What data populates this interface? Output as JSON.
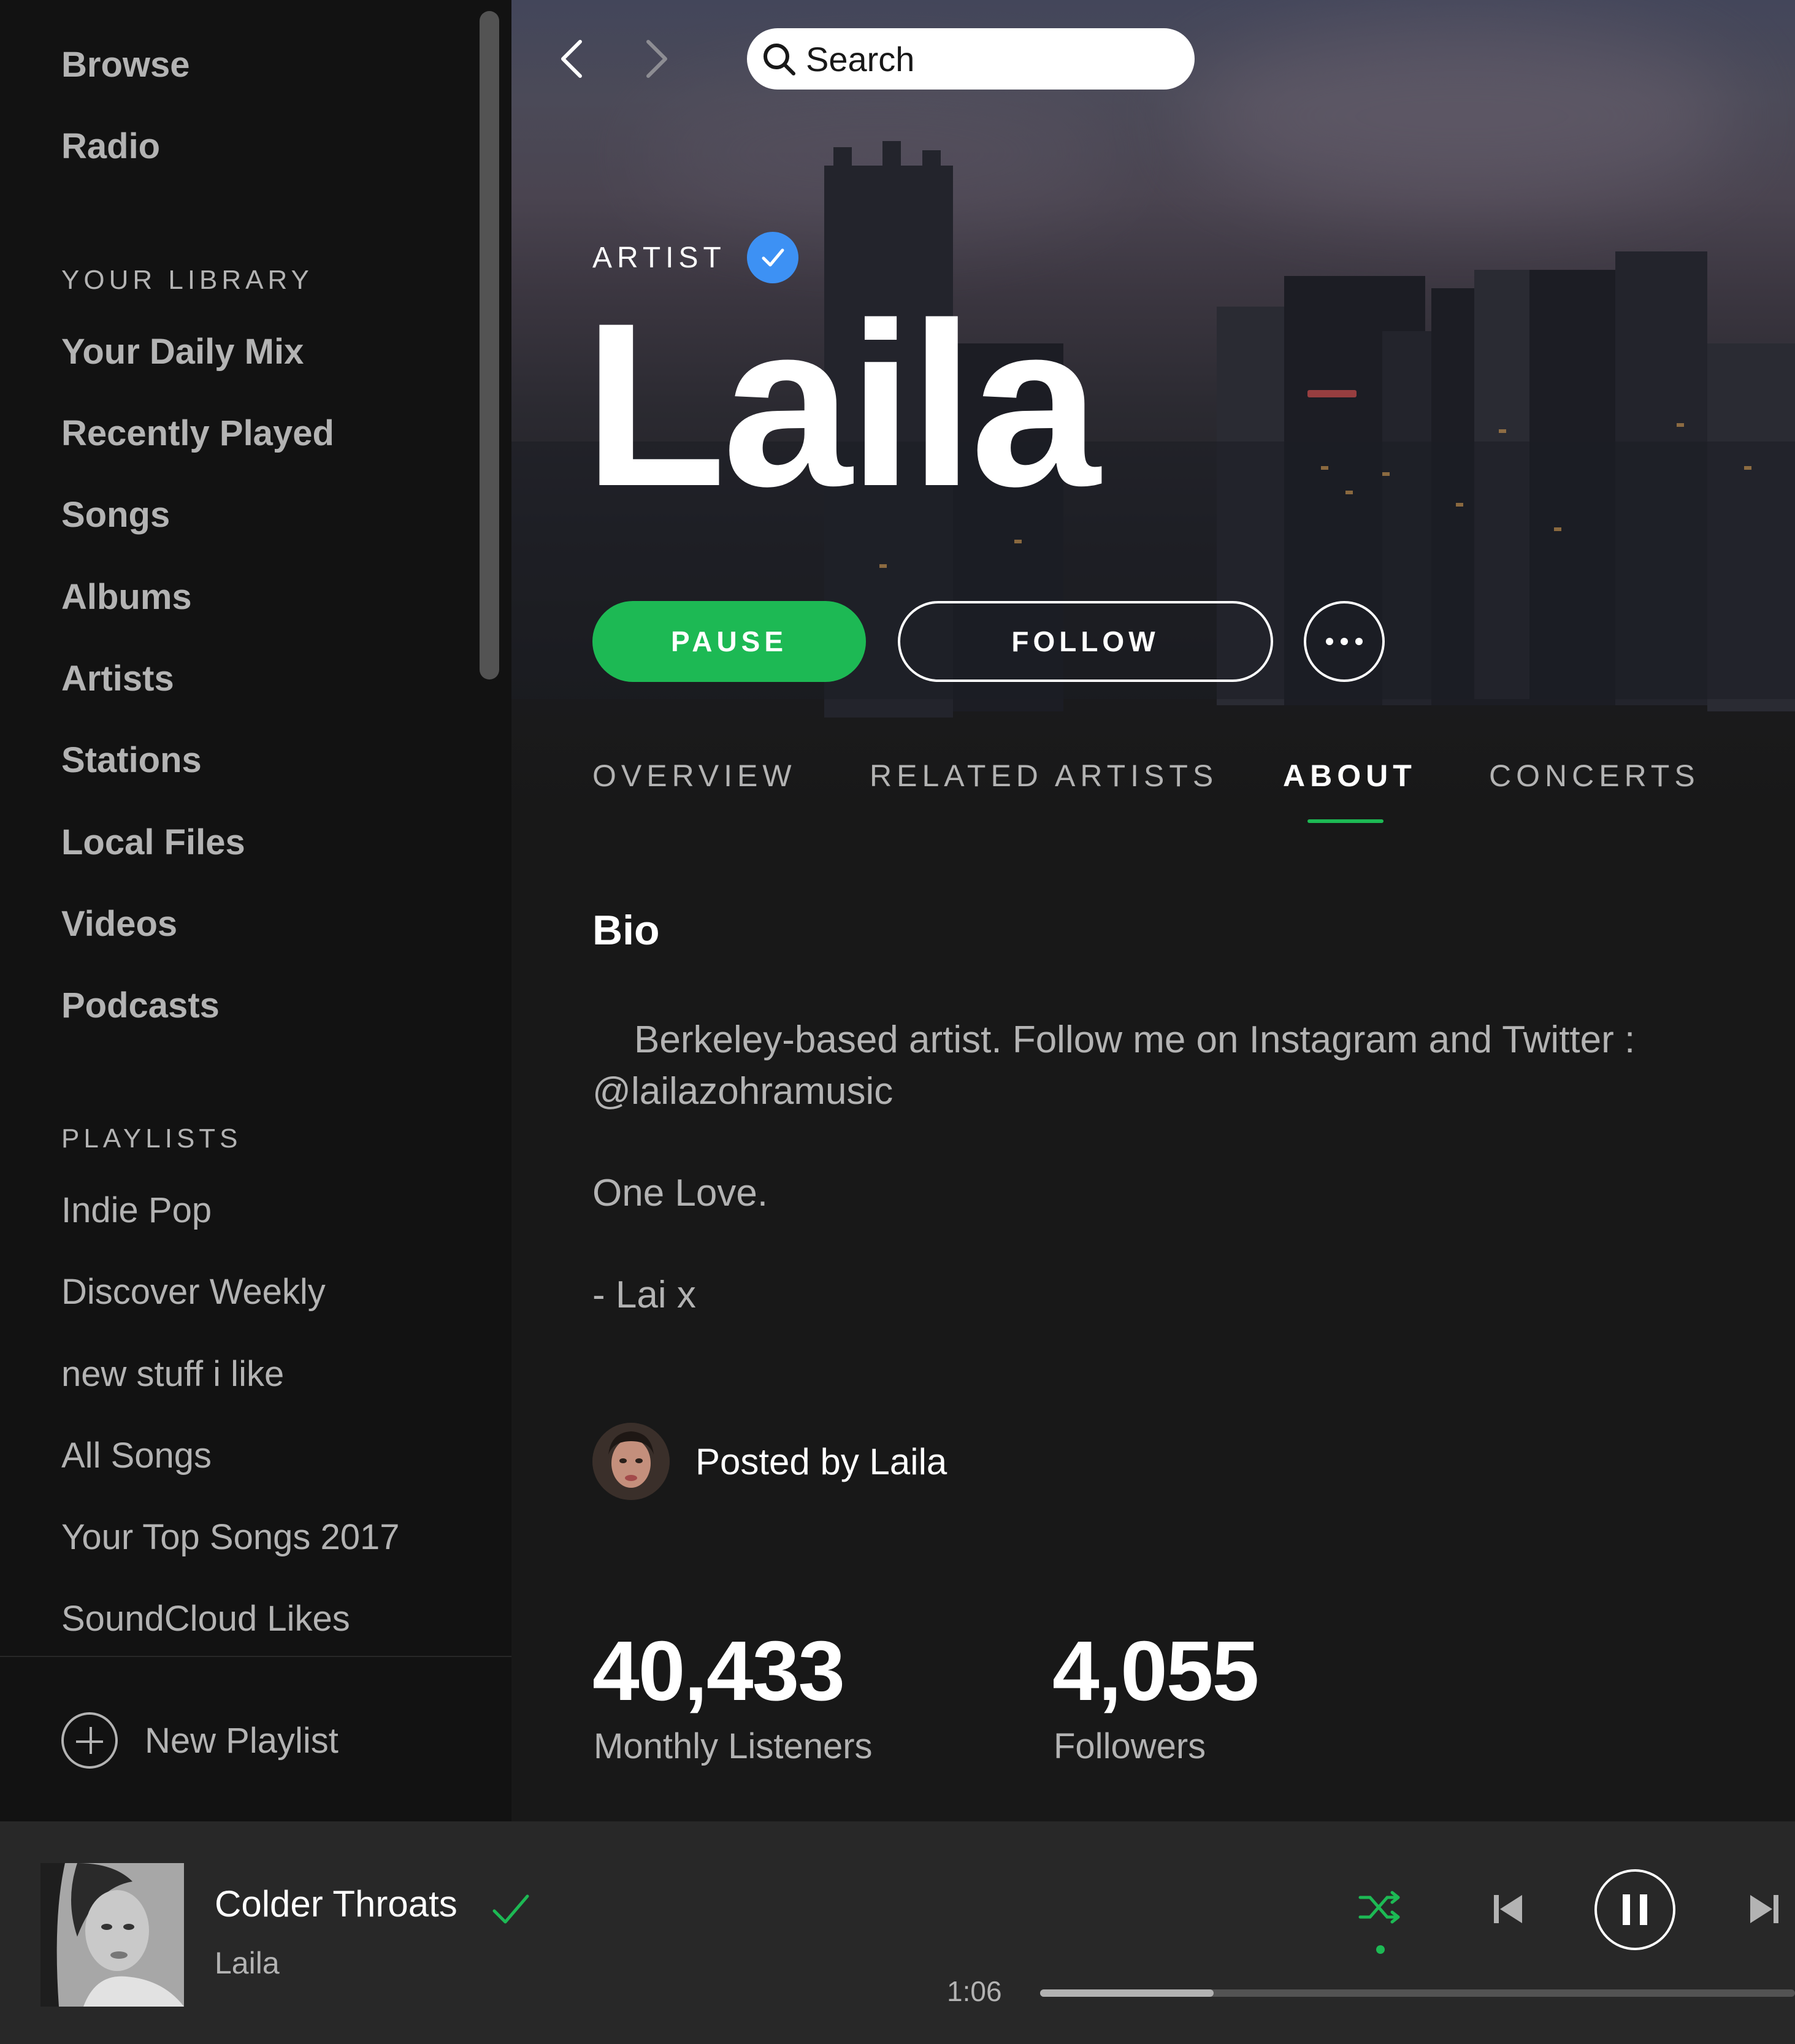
{
  "sidebar": {
    "nav": [
      "Browse",
      "Radio"
    ],
    "library_label": "YOUR LIBRARY",
    "library_items": [
      "Your Daily Mix",
      "Recently Played",
      "Songs",
      "Albums",
      "Artists",
      "Stations",
      "Local Files",
      "Videos",
      "Podcasts"
    ],
    "playlists_label": "PLAYLISTS",
    "playlists": [
      "Indie Pop",
      "Discover Weekly",
      "new stuff i like",
      "All Songs",
      "Your Top Songs 2017",
      "SoundCloud Likes"
    ],
    "new_playlist_label": "New Playlist"
  },
  "header": {
    "search_placeholder": "Search"
  },
  "artist": {
    "tag": "ARTIST",
    "name": "Laila",
    "pause_label": "PAUSE",
    "follow_label": "FOLLOW"
  },
  "tabs": [
    {
      "label": "OVERVIEW",
      "active": false
    },
    {
      "label": "RELATED ARTISTS",
      "active": false
    },
    {
      "label": "ABOUT",
      "active": true
    },
    {
      "label": "CONCERTS",
      "active": false
    }
  ],
  "about": {
    "bio_heading": "Bio",
    "bio_lines": [
      "Berkeley-based artist. Follow me on Instagram and Twitter :",
      "@lailazohramusic",
      "One Love.",
      "- Lai x"
    ],
    "posted_by": "Posted by Laila",
    "stats": [
      {
        "value": "40,433",
        "label": "Monthly Listeners"
      },
      {
        "value": "4,055",
        "label": "Followers"
      }
    ]
  },
  "player": {
    "track_title": "Colder Throats",
    "track_artist": "Laila",
    "elapsed": "1:06",
    "progress_fraction": 0.23,
    "shuffle_active": true
  },
  "icons": {
    "back": "chevron-left-icon",
    "forward": "chevron-right-icon",
    "search": "search-icon",
    "verified": "verified-check-icon",
    "more": "more-dots-icon",
    "add": "plus-circle-icon",
    "saved": "checkmark-icon",
    "shuffle": "shuffle-icon",
    "previous": "skip-back-icon",
    "pause": "pause-icon",
    "next": "skip-forward-icon"
  },
  "colors": {
    "accent": "#1db954",
    "verified": "#3d91f4",
    "background": "#181818",
    "sidebar": "#121212",
    "player": "#282828"
  }
}
